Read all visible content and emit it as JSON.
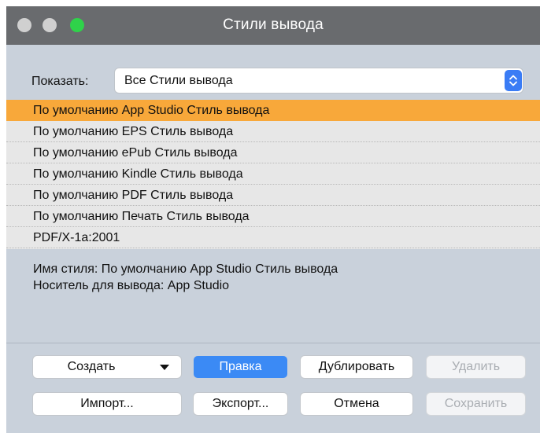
{
  "window": {
    "title": "Стили вывода"
  },
  "filter": {
    "label": "Показать:",
    "value": "Все Стили вывода"
  },
  "styles": [
    {
      "label": "По умолчанию App Studio Стиль вывода",
      "selected": true
    },
    {
      "label": "По умолчанию EPS Стиль вывода",
      "selected": false
    },
    {
      "label": "По умолчанию ePub Стиль вывода",
      "selected": false
    },
    {
      "label": "По умолчанию Kindle Стиль вывода",
      "selected": false
    },
    {
      "label": "По умолчанию PDF Стиль вывода",
      "selected": false
    },
    {
      "label": "По умолчанию Печать Стиль вывода",
      "selected": false
    },
    {
      "label": "PDF/X-1a:2001",
      "selected": false
    }
  ],
  "info": {
    "style_name": "Имя стиля: По умолчанию App Studio Стиль вывода",
    "output_media": "Носитель для вывода: App Studio"
  },
  "buttons": {
    "create": "Создать",
    "edit": "Правка",
    "duplicate": "Дублировать",
    "delete": "Удалить",
    "import": "Импорт...",
    "export": "Экспорт...",
    "cancel": "Отмена",
    "save": "Сохранить"
  },
  "colors": {
    "selection": "#f8a83a",
    "accent": "#3b8af5",
    "zoom_light": "#2fd24a",
    "titlebar": "#696b6e"
  }
}
